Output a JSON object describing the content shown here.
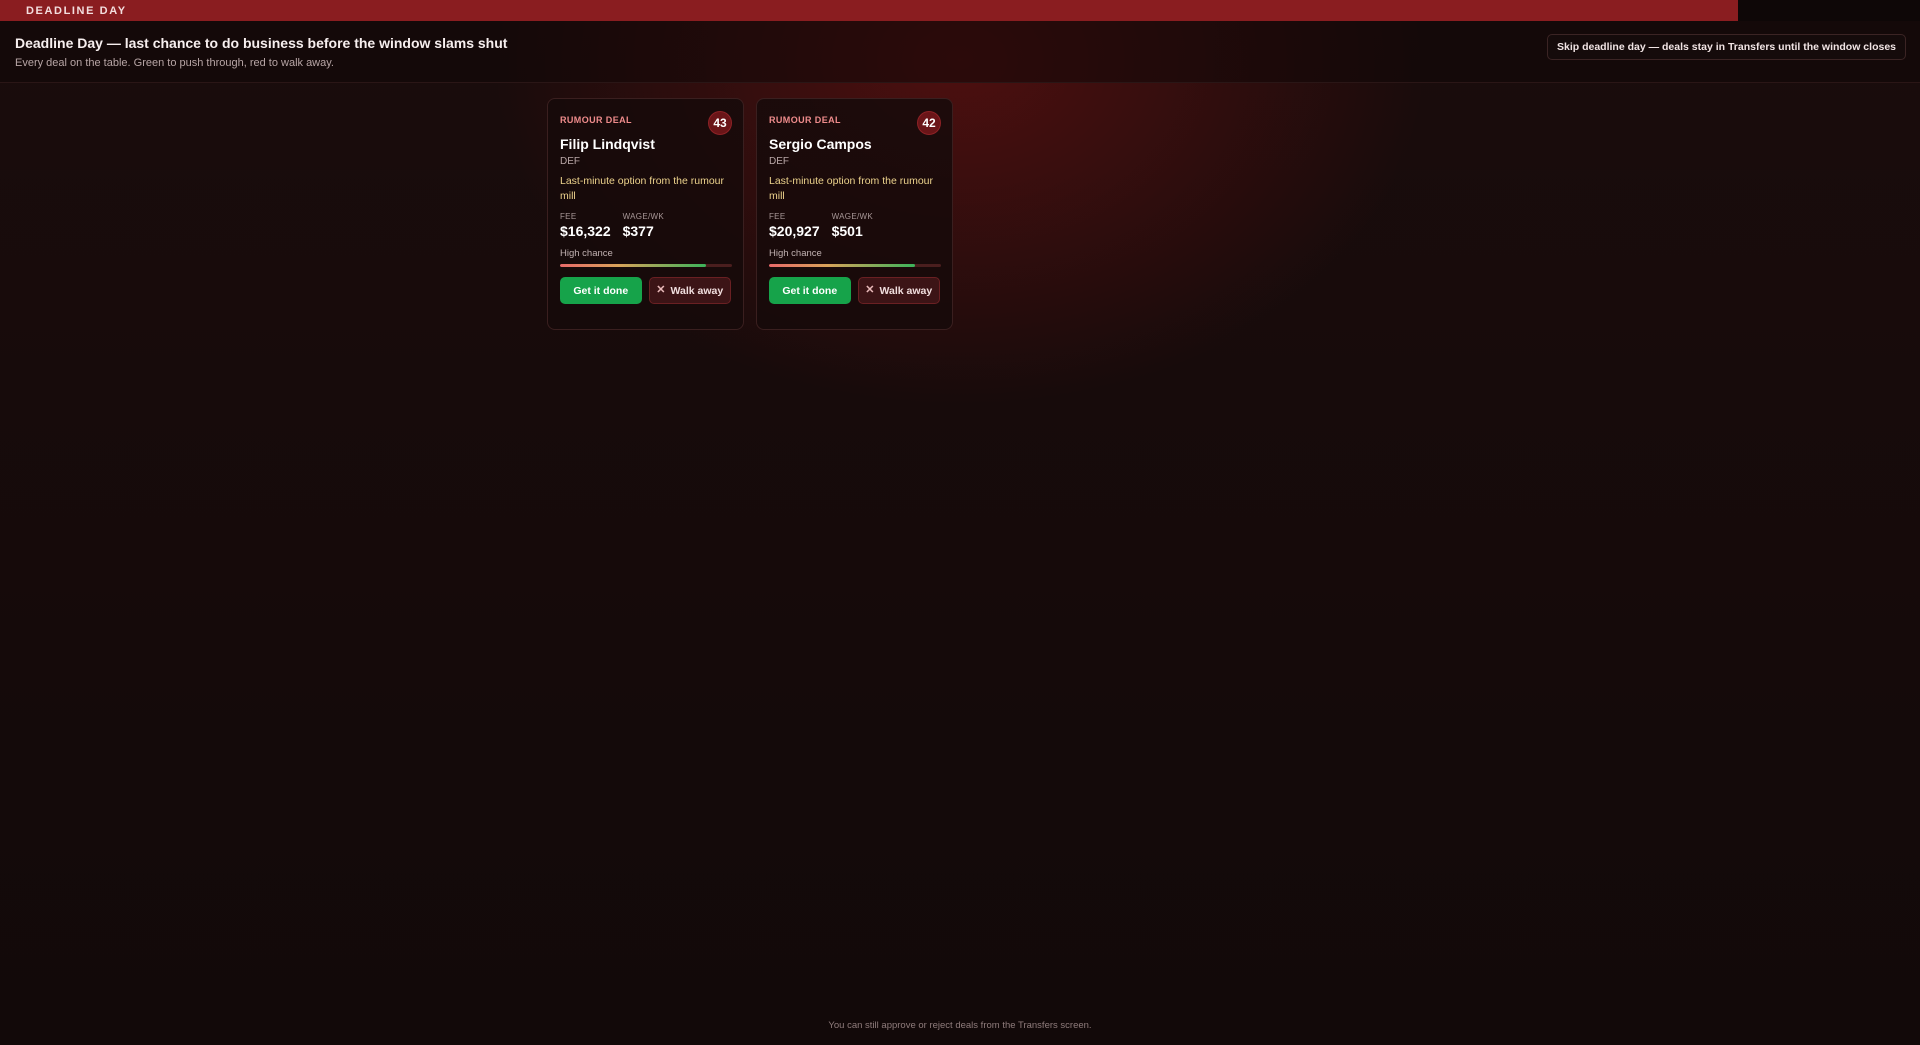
{
  "topbar": {
    "label": "DEADLINE DAY"
  },
  "header": {
    "title": "Deadline Day — last chance to do business before the window slams shut",
    "subtitle": "Every deal on the table. Green to push through, red to walk away.",
    "skip_label": "Skip deadline day — deals stay in Transfers until the window closes"
  },
  "deals": [
    {
      "type": "RUMOUR DEAL",
      "rating": "43",
      "name": "Filip Lindqvist",
      "position": "DEF",
      "note": "Last-minute option from the rumour mill",
      "fee_label": "FEE",
      "fee": "$16,322",
      "wage_label": "WAGE/WK",
      "wage": "$377",
      "chance_label": "High chance",
      "chance_fraction": 0.85,
      "go_label": "Get it done",
      "walk_label": "Walk away"
    },
    {
      "type": "RUMOUR DEAL",
      "rating": "42",
      "name": "Sergio Campos",
      "position": "DEF",
      "note": "Last-minute option from the rumour mill",
      "fee_label": "FEE",
      "fee": "$20,927",
      "wage_label": "WAGE/WK",
      "wage": "$501",
      "chance_label": "High chance",
      "chance_fraction": 0.85,
      "go_label": "Get it done",
      "walk_label": "Walk away"
    }
  ],
  "footer": {
    "note": "You can still approve or reject deals from the Transfers screen."
  },
  "icons": {
    "walk": "close-icon"
  },
  "colors": {
    "accent": "#8a1d20",
    "go": "#16a34a",
    "walk": "#3c1416"
  }
}
